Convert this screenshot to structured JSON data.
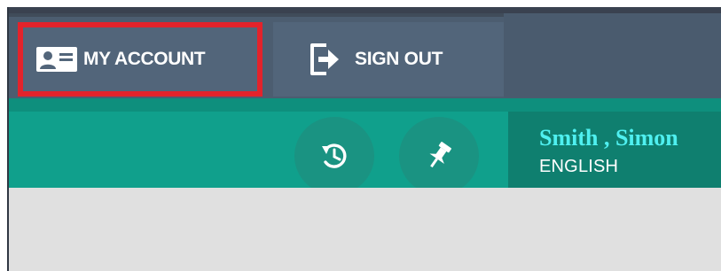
{
  "header": {
    "my_account_label": "MY ACCOUNT",
    "sign_out_label": "SIGN OUT",
    "icons": {
      "account": "id-card-icon",
      "sign_out": "sign-out-icon"
    }
  },
  "toolbar": {
    "history_icon": "history-icon",
    "pin_icon": "pin-icon"
  },
  "user": {
    "name": "Smith , Simon",
    "language": "ENGLISH"
  },
  "colors": {
    "nav_bg": "#4c5d70",
    "teal_bar": "#10a08c",
    "highlight_border": "#e3232b",
    "user_name": "#4ff0f0",
    "content_bg": "#e0e0e0"
  }
}
